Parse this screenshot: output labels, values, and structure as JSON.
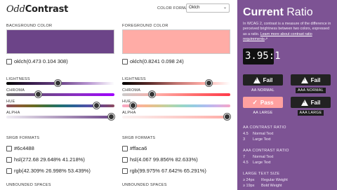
{
  "header": {
    "logo_part1": "Odd",
    "logo_part2": "Contrast",
    "color_format_label": "COLOR FORMAT",
    "color_format_value": "Oklch"
  },
  "background": {
    "label": "BACKGROUND COLOR",
    "swatch_color": "#6c4488",
    "value": "oklch(0.473 0.104 308)",
    "sliders": [
      {
        "label": "LIGHTNESS",
        "fraction": 0.473
      },
      {
        "label": "CHROMA",
        "fraction": 0.28
      },
      {
        "label": "HUE",
        "fraction": 0.86
      },
      {
        "label": "ALPHA",
        "fraction": 1.0
      }
    ],
    "srgb_label": "SRGB FORMATS",
    "hex": "#6c4488",
    "hsl": "hsl(272.68 29.648% 41.218%)",
    "rgb": "rgb(42.309% 26.998% 53.439%)",
    "unbounded_label": "UNBOUNDED SPACES"
  },
  "foreground": {
    "label": "FOREGROUND COLOR",
    "swatch_color": "#ffaca6",
    "value": "oklch(0.8241 0.098 24)",
    "sliders": [
      {
        "label": "LIGHTNESS",
        "fraction": 0.8241
      },
      {
        "label": "CHROMA",
        "fraction": 0.26
      },
      {
        "label": "HUE",
        "fraction": 0.07
      },
      {
        "label": "ALPHA",
        "fraction": 1.0
      }
    ],
    "srgb_label": "SRGB FORMATS",
    "hex": "#ffaca6",
    "hsl": "hsl(4.067 99.856% 82.633%)",
    "rgb": "rgb(99.975% 67.642% 65.291%)",
    "unbounded_label": "UNBOUNDED SPACES"
  },
  "panel": {
    "bg_color": "#7d5394",
    "title_bold": "Current",
    "title_rest": "Ratio",
    "intro_text": "In WCAG 2, contrast is a measure of the difference in perceived brightness between two colors, expressed as a ratio.",
    "intro_link": "Learn more about contrast ratio requirements",
    "ratio": "3.95:1",
    "badges": [
      {
        "result": "Fail",
        "label": "AA NORMAL",
        "pass": false
      },
      {
        "result": "Fail",
        "label": "AAA NORMAL",
        "pass": false
      },
      {
        "result": "Pass",
        "label": "AA LARGE",
        "pass": true
      },
      {
        "result": "Fail",
        "label": "AAA LARGE",
        "pass": false
      }
    ],
    "aa_head": "AA CONTRAST RATIO",
    "aa_rows": [
      {
        "value": "4.5",
        "text": "Normal Text"
      },
      {
        "value": "3",
        "text": "Large Text"
      }
    ],
    "aaa_head": "AAA CONTRAST RATIO",
    "aaa_rows": [
      {
        "value": "7",
        "text": "Normal Text"
      },
      {
        "value": "4.5",
        "text": "Large Text"
      }
    ],
    "large_head": "LARGE TEXT SIZE",
    "large_rows": [
      {
        "value": "≥ 24px",
        "text": "Regular Weight"
      },
      {
        "value": "≥ 19px",
        "text": "Bold Weight"
      }
    ]
  }
}
